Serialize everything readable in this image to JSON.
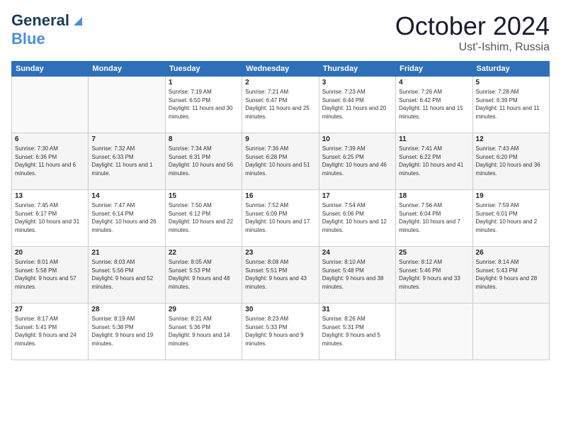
{
  "logo": {
    "line1": "General",
    "line2": "Blue"
  },
  "title": {
    "month": "October 2024",
    "location": "Ust'-Ishim, Russia"
  },
  "weekdays": [
    "Sunday",
    "Monday",
    "Tuesday",
    "Wednesday",
    "Thursday",
    "Friday",
    "Saturday"
  ],
  "weeks": [
    [
      {
        "day": "",
        "sunrise": "",
        "sunset": "",
        "daylight": ""
      },
      {
        "day": "",
        "sunrise": "",
        "sunset": "",
        "daylight": ""
      },
      {
        "day": "1",
        "sunrise": "Sunrise: 7:19 AM",
        "sunset": "Sunset: 6:50 PM",
        "daylight": "Daylight: 11 hours and 30 minutes."
      },
      {
        "day": "2",
        "sunrise": "Sunrise: 7:21 AM",
        "sunset": "Sunset: 6:47 PM",
        "daylight": "Daylight: 11 hours and 25 minutes."
      },
      {
        "day": "3",
        "sunrise": "Sunrise: 7:23 AM",
        "sunset": "Sunset: 6:44 PM",
        "daylight": "Daylight: 11 hours and 20 minutes."
      },
      {
        "day": "4",
        "sunrise": "Sunrise: 7:26 AM",
        "sunset": "Sunset: 6:42 PM",
        "daylight": "Daylight: 11 hours and 15 minutes."
      },
      {
        "day": "5",
        "sunrise": "Sunrise: 7:28 AM",
        "sunset": "Sunset: 6:39 PM",
        "daylight": "Daylight: 11 hours and 11 minutes."
      }
    ],
    [
      {
        "day": "6",
        "sunrise": "Sunrise: 7:30 AM",
        "sunset": "Sunset: 6:36 PM",
        "daylight": "Daylight: 11 hours and 6 minutes."
      },
      {
        "day": "7",
        "sunrise": "Sunrise: 7:32 AM",
        "sunset": "Sunset: 6:33 PM",
        "daylight": "Daylight: 11 hours and 1 minute."
      },
      {
        "day": "8",
        "sunrise": "Sunrise: 7:34 AM",
        "sunset": "Sunset: 6:31 PM",
        "daylight": "Daylight: 10 hours and 56 minutes."
      },
      {
        "day": "9",
        "sunrise": "Sunrise: 7:36 AM",
        "sunset": "Sunset: 6:28 PM",
        "daylight": "Daylight: 10 hours and 51 minutes."
      },
      {
        "day": "10",
        "sunrise": "Sunrise: 7:39 AM",
        "sunset": "Sunset: 6:25 PM",
        "daylight": "Daylight: 10 hours and 46 minutes."
      },
      {
        "day": "11",
        "sunrise": "Sunrise: 7:41 AM",
        "sunset": "Sunset: 6:22 PM",
        "daylight": "Daylight: 10 hours and 41 minutes."
      },
      {
        "day": "12",
        "sunrise": "Sunrise: 7:43 AM",
        "sunset": "Sunset: 6:20 PM",
        "daylight": "Daylight: 10 hours and 36 minutes."
      }
    ],
    [
      {
        "day": "13",
        "sunrise": "Sunrise: 7:45 AM",
        "sunset": "Sunset: 6:17 PM",
        "daylight": "Daylight: 10 hours and 31 minutes."
      },
      {
        "day": "14",
        "sunrise": "Sunrise: 7:47 AM",
        "sunset": "Sunset: 6:14 PM",
        "daylight": "Daylight: 10 hours and 26 minutes."
      },
      {
        "day": "15",
        "sunrise": "Sunrise: 7:50 AM",
        "sunset": "Sunset: 6:12 PM",
        "daylight": "Daylight: 10 hours and 22 minutes."
      },
      {
        "day": "16",
        "sunrise": "Sunrise: 7:52 AM",
        "sunset": "Sunset: 6:09 PM",
        "daylight": "Daylight: 10 hours and 17 minutes."
      },
      {
        "day": "17",
        "sunrise": "Sunrise: 7:54 AM",
        "sunset": "Sunset: 6:06 PM",
        "daylight": "Daylight: 10 hours and 12 minutes."
      },
      {
        "day": "18",
        "sunrise": "Sunrise: 7:56 AM",
        "sunset": "Sunset: 6:04 PM",
        "daylight": "Daylight: 10 hours and 7 minutes."
      },
      {
        "day": "19",
        "sunrise": "Sunrise: 7:59 AM",
        "sunset": "Sunset: 6:01 PM",
        "daylight": "Daylight: 10 hours and 2 minutes."
      }
    ],
    [
      {
        "day": "20",
        "sunrise": "Sunrise: 8:01 AM",
        "sunset": "Sunset: 5:58 PM",
        "daylight": "Daylight: 9 hours and 57 minutes."
      },
      {
        "day": "21",
        "sunrise": "Sunrise: 8:03 AM",
        "sunset": "Sunset: 5:56 PM",
        "daylight": "Daylight: 9 hours and 52 minutes."
      },
      {
        "day": "22",
        "sunrise": "Sunrise: 8:05 AM",
        "sunset": "Sunset: 5:53 PM",
        "daylight": "Daylight: 9 hours and 48 minutes."
      },
      {
        "day": "23",
        "sunrise": "Sunrise: 8:08 AM",
        "sunset": "Sunset: 5:51 PM",
        "daylight": "Daylight: 9 hours and 43 minutes."
      },
      {
        "day": "24",
        "sunrise": "Sunrise: 8:10 AM",
        "sunset": "Sunset: 5:48 PM",
        "daylight": "Daylight: 9 hours and 38 minutes."
      },
      {
        "day": "25",
        "sunrise": "Sunrise: 8:12 AM",
        "sunset": "Sunset: 5:46 PM",
        "daylight": "Daylight: 9 hours and 33 minutes."
      },
      {
        "day": "26",
        "sunrise": "Sunrise: 8:14 AM",
        "sunset": "Sunset: 5:43 PM",
        "daylight": "Daylight: 9 hours and 28 minutes."
      }
    ],
    [
      {
        "day": "27",
        "sunrise": "Sunrise: 8:17 AM",
        "sunset": "Sunset: 5:41 PM",
        "daylight": "Daylight: 9 hours and 24 minutes."
      },
      {
        "day": "28",
        "sunrise": "Sunrise: 8:19 AM",
        "sunset": "Sunset: 5:38 PM",
        "daylight": "Daylight: 9 hours and 19 minutes."
      },
      {
        "day": "29",
        "sunrise": "Sunrise: 8:21 AM",
        "sunset": "Sunset: 5:36 PM",
        "daylight": "Daylight: 9 hours and 14 minutes."
      },
      {
        "day": "30",
        "sunrise": "Sunrise: 8:23 AM",
        "sunset": "Sunset: 5:33 PM",
        "daylight": "Daylight: 9 hours and 9 minutes."
      },
      {
        "day": "31",
        "sunrise": "Sunrise: 8:26 AM",
        "sunset": "Sunset: 5:31 PM",
        "daylight": "Daylight: 9 hours and 5 minutes."
      },
      {
        "day": "",
        "sunrise": "",
        "sunset": "",
        "daylight": ""
      },
      {
        "day": "",
        "sunrise": "",
        "sunset": "",
        "daylight": ""
      }
    ]
  ]
}
